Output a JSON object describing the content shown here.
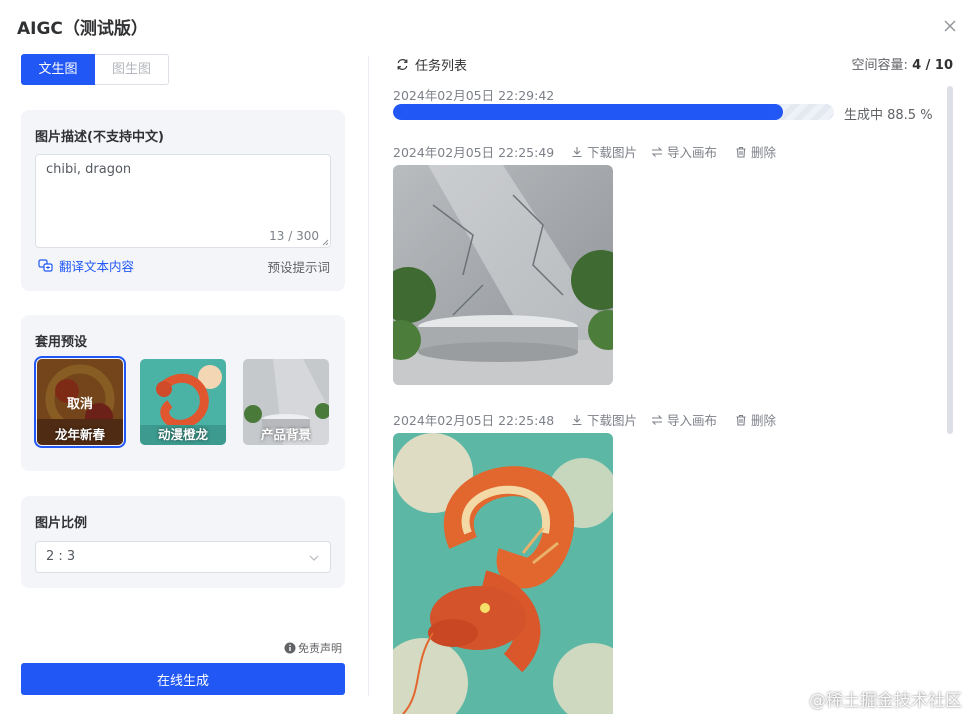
{
  "dialog": {
    "title": "AIGC（测试版）"
  },
  "tabs": [
    {
      "label": "文生图",
      "active": true
    },
    {
      "label": "图生图",
      "active": false
    }
  ],
  "prompt": {
    "title": "图片描述(不支持中文)",
    "value": "chibi, dragon",
    "count": "13 / 300",
    "translate_label": "翻译文本内容",
    "preset_words_label": "预设提示词"
  },
  "presets": {
    "title": "套用预设",
    "items": [
      {
        "label": "龙年新春",
        "selected": true,
        "cancel_label": "取消",
        "icon": "new-year-dragon-thumbnail"
      },
      {
        "label": "动漫橙龙",
        "selected": false,
        "icon": "anime-orange-dragon-thumbnail"
      },
      {
        "label": "产品背景",
        "selected": false,
        "icon": "product-background-thumbnail"
      }
    ]
  },
  "ratio": {
    "title": "图片比例",
    "value": "2 : 3"
  },
  "disclaimer": "免责声明",
  "generate_button": "在线生成",
  "right": {
    "task_list_label": "任务列表",
    "capacity_label": "空间容量:",
    "capacity_value": "4 / 10",
    "tasks": [
      {
        "time": "2024年02月05日 22:29:42",
        "status": "生成中 88.5 %",
        "progress": 0.885
      },
      {
        "time": "2024年02月05日 22:25:49",
        "actions": [
          "下载图片",
          "导入画布",
          "删除"
        ],
        "image": "stone-podium-product-background"
      },
      {
        "time": "2024年02月05日 22:25:48",
        "actions": [
          "下载图片",
          "导入画布",
          "删除"
        ],
        "image": "orange-dragon-illustration"
      }
    ]
  },
  "watermark": "@稀土掘金技术社区",
  "colors": {
    "primary": "#2157f5",
    "card_bg": "#f3f5f9",
    "muted_text": "#7d8189"
  }
}
